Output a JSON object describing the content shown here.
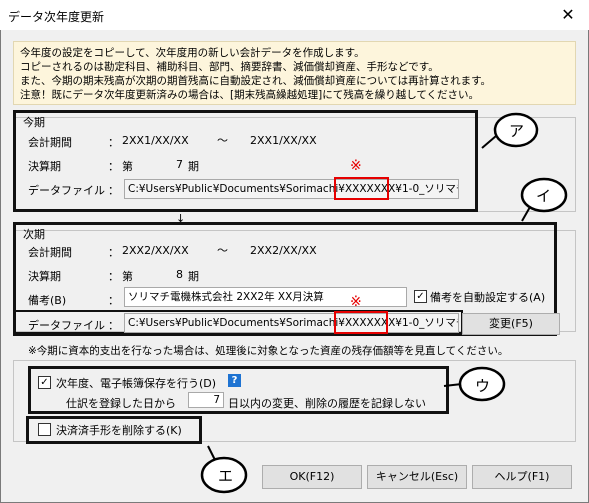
{
  "window": {
    "title": "データ次年度更新",
    "close": "✕"
  },
  "info": {
    "lines": [
      "今年度の設定をコピーして、次年度用の新しい会計データを作成します。",
      "コピーされるのは勘定科目、補助科目、部門、摘要辞書、減価償却資産、手形などです。",
      "また、今期の期末残高が次期の期首残高に自動設定され、減価償却資産については再計算されます。",
      "注意！既にデータ次年度更新済みの場合は、[期末残高繰越処理]にて残高を繰り越してください。"
    ]
  },
  "current": {
    "group_title": "今期",
    "period_label": "会計期間",
    "period_from": "2XX1/XX/XX",
    "period_sep": "〜",
    "period_to": "2XX1/XX/XX",
    "term_label": "決算期",
    "term_prefix": "第",
    "term_value": "7",
    "term_suffix": "期",
    "file_label": "データファイル",
    "file_path": "C:¥Users¥Public¥Documents¥Sorimachi¥XXXXXXX¥1-0_ソリマチ"
  },
  "next": {
    "group_title": "次期",
    "period_label": "会計期間",
    "period_from": "2XX2/XX/XX",
    "period_sep": "〜",
    "period_to": "2XX2/XX/XX",
    "term_label": "決算期",
    "term_prefix": "第",
    "term_value": "8",
    "term_suffix": "期",
    "memo_label": "備考(B)",
    "memo_value": "ソリマチ電機株式会社 2XX2年 XX月決算",
    "auto_memo_label": "備考を自動設定する(A)",
    "auto_memo_checked": true,
    "file_label": "データファイル",
    "file_path": "C:¥Users¥Public¥Documents¥Sorimachi¥XXXXXXX¥1-0_ソリマチ",
    "change_button": "変更(F5)"
  },
  "colon": "：",
  "notice": "※今期に資本的支出を行なった場合は、処理後に対象となった資産の残存価額等を見直してください。",
  "ebook": {
    "label": "次年度、電子帳簿保存を行う(D)",
    "checked": true,
    "help": "?",
    "days_prefix": "仕訳を登録した日から",
    "days_value": "7",
    "days_suffix": "日以内の変更、削除の履歴を記録しない"
  },
  "delete_settled": {
    "label": "決済済手形を削除する(K)",
    "checked": false
  },
  "buttons": {
    "ok": "OK(F12)",
    "cancel": "キャンセル(Esc)",
    "help": "ヘルプ(F1)"
  },
  "annotations": {
    "a": "ア",
    "i": "イ",
    "u": "ウ",
    "e": "エ",
    "mark": "※"
  },
  "check_glyph": "✓",
  "arrow_glyph": "↓"
}
